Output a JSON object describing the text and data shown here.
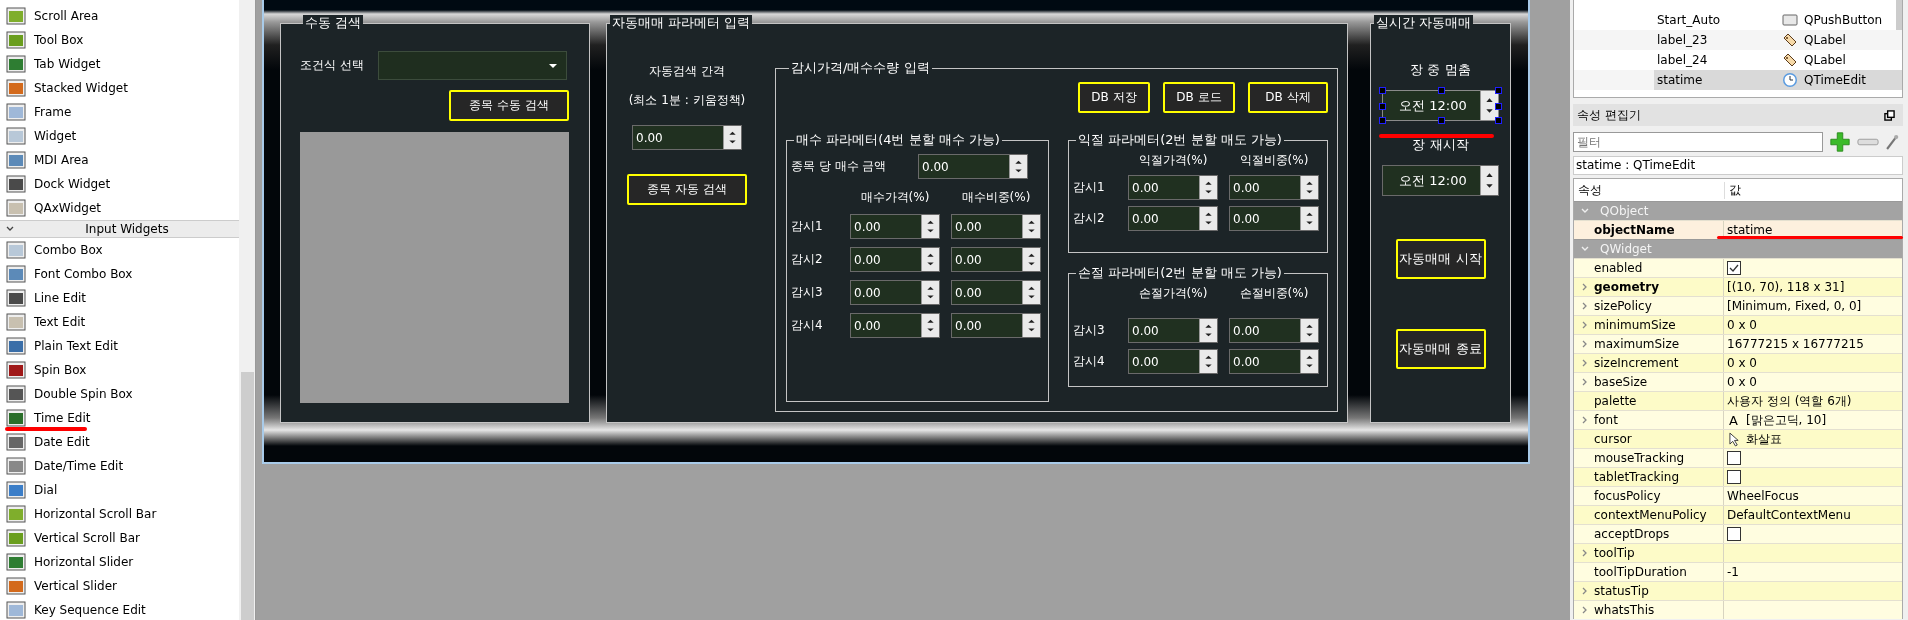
{
  "widget_box": {
    "items_above": [
      "Scroll Area",
      "Tool Box",
      "Tab Widget",
      "Stacked Widget",
      "Frame",
      "Widget",
      "MDI Area",
      "Dock Widget",
      "QAxWidget"
    ],
    "category": {
      "label": "Input Widgets",
      "expanded": true
    },
    "items": [
      "Combo Box",
      "Font Combo Box",
      "Line Edit",
      "Text Edit",
      "Plain Text Edit",
      "Spin Box",
      "Double Spin Box",
      "Time Edit",
      "Date Edit",
      "Date/Time Edit",
      "Dial",
      "Horizontal Scroll Bar",
      "Vertical Scroll Bar",
      "Horizontal Slider",
      "Vertical Slider",
      "Key Sequence Edit"
    ]
  },
  "form": {
    "manual_search": {
      "title": "수동 검색",
      "condition_label": "조건식 선택",
      "search_button": "종목 수동 검색"
    },
    "auto_params": {
      "title": "자동매매 파라메터 입력",
      "interval_label": "자동검색 간격",
      "interval_note": "(최소 1분 : 키움정책)",
      "interval_value": "0.00",
      "auto_search_button": "종목 자동 검색",
      "watch_group": {
        "title": "감시가격/매수수량 입력",
        "db_buttons": [
          "DB 저장",
          "DB 로드",
          "DB 삭제"
        ],
        "buy": {
          "title": "매수 파라메터(4번 분할 매수 가능)",
          "amount_label": "종목 당 매수 금액",
          "amount_value": "0.00",
          "columns": [
            "매수가격(%)",
            "매수비중(%)"
          ],
          "rows": [
            {
              "label": "감시1",
              "values": [
                "0.00",
                "0.00"
              ]
            },
            {
              "label": "감시2",
              "values": [
                "0.00",
                "0.00"
              ]
            },
            {
              "label": "감시3",
              "values": [
                "0.00",
                "0.00"
              ]
            },
            {
              "label": "감시4",
              "values": [
                "0.00",
                "0.00"
              ]
            }
          ]
        },
        "take_profit": {
          "title": "익절 파라메터(2번 분할 매도 가능)",
          "columns": [
            "익절가격(%)",
            "익절비중(%)"
          ],
          "rows": [
            {
              "label": "감시1",
              "values": [
                "0.00",
                "0.00"
              ]
            },
            {
              "label": "감시2",
              "values": [
                "0.00",
                "0.00"
              ]
            }
          ]
        },
        "stop_loss": {
          "title": "손절 파라메터(2번 분할 매도 가능)",
          "columns": [
            "손절가격(%)",
            "손절비중(%)"
          ],
          "rows": [
            {
              "label": "감시3",
              "values": [
                "0.00",
                "0.00"
              ]
            },
            {
              "label": "감시4",
              "values": [
                "0.00",
                "0.00"
              ]
            }
          ]
        }
      }
    },
    "realtime": {
      "title": "실시간 자동매매",
      "times": [
        {
          "label": "장 중 멈춤",
          "value": "오전 12:00",
          "selected": true
        },
        {
          "label": "장 재시작",
          "value": "오전 12:00",
          "selected": false
        }
      ],
      "buttons": [
        "자동매매 시작",
        "자동매매 종료"
      ]
    }
  },
  "object_inspector": {
    "rows": [
      {
        "name": "Start_Auto",
        "class": "QPushButton",
        "kind": "button",
        "selected": false
      },
      {
        "name": "label_23",
        "class": "QLabel",
        "kind": "label",
        "selected": false
      },
      {
        "name": "label_24",
        "class": "QLabel",
        "kind": "label",
        "selected": false
      },
      {
        "name": "statime",
        "class": "QTimeEdit",
        "kind": "time",
        "selected": true
      }
    ]
  },
  "property_editor": {
    "title": "속성 편집기",
    "filter_placeholder": "필터",
    "object_label": "statime : QTimeEdit",
    "columns": [
      "속성",
      "값"
    ],
    "groups": [
      {
        "name": "QObject",
        "expanded": true,
        "properties": [
          {
            "name": "objectName",
            "value": "statime",
            "kind": "text",
            "modified": true,
            "expandable": false
          }
        ]
      },
      {
        "name": "QWidget",
        "expanded": true,
        "properties": [
          {
            "name": "enabled",
            "kind": "check",
            "checked": true,
            "modified": false,
            "expandable": false
          },
          {
            "name": "geometry",
            "value": "[(10, 70), 118 x 31]",
            "kind": "text",
            "modified": true,
            "expandable": true
          },
          {
            "name": "sizePolicy",
            "value": "[Minimum, Fixed, 0, 0]",
            "kind": "text",
            "modified": false,
            "expandable": true
          },
          {
            "name": "minimumSize",
            "value": "0 x 0",
            "kind": "text",
            "modified": false,
            "expandable": true
          },
          {
            "name": "maximumSize",
            "value": "16777215 x 16777215",
            "kind": "text",
            "modified": false,
            "expandable": true
          },
          {
            "name": "sizeIncrement",
            "value": "0 x 0",
            "kind": "text",
            "modified": false,
            "expandable": true
          },
          {
            "name": "baseSize",
            "value": "0 x 0",
            "kind": "text",
            "modified": false,
            "expandable": true
          },
          {
            "name": "palette",
            "value": "사용자 정의 (역할 6개)",
            "kind": "text",
            "modified": false,
            "expandable": false
          },
          {
            "name": "font",
            "icon_text": "A",
            "value": "[맑은고딕, 10]",
            "kind": "font",
            "modified": false,
            "expandable": true
          },
          {
            "name": "cursor",
            "value": "화살표",
            "kind": "cursor",
            "modified": false,
            "expandable": false
          },
          {
            "name": "mouseTracking",
            "kind": "check",
            "checked": false,
            "modified": false,
            "expandable": false
          },
          {
            "name": "tabletTracking",
            "kind": "check",
            "checked": false,
            "modified": false,
            "expandable": false
          },
          {
            "name": "focusPolicy",
            "value": "WheelFocus",
            "kind": "text",
            "modified": false,
            "expandable": false
          },
          {
            "name": "contextMenuPolicy",
            "value": "DefaultContextMenu",
            "kind": "text",
            "modified": false,
            "expandable": false
          },
          {
            "name": "acceptDrops",
            "kind": "check",
            "checked": false,
            "modified": false,
            "expandable": false
          },
          {
            "name": "toolTip",
            "kind": "text",
            "modified": false,
            "expandable": true
          },
          {
            "name": "toolTipDuration",
            "value": "-1",
            "kind": "text",
            "modified": false,
            "expandable": false
          },
          {
            "name": "statusTip",
            "kind": "text",
            "modified": false,
            "expandable": true
          },
          {
            "name": "whatsThis",
            "kind": "text",
            "modified": false,
            "expandable": true
          }
        ]
      }
    ]
  }
}
